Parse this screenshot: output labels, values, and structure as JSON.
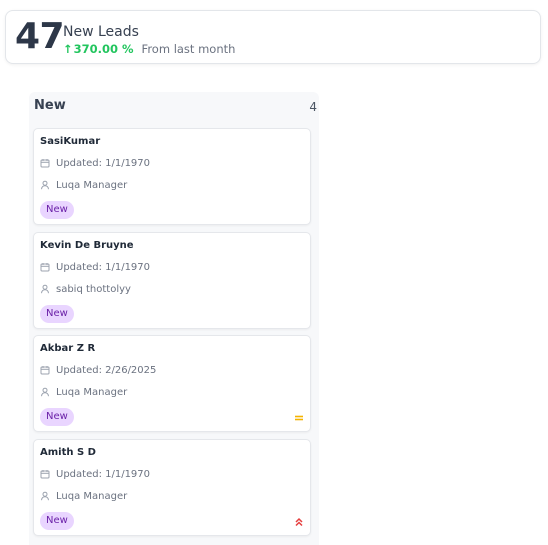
{
  "stat": {
    "number": "47",
    "title": "New Leads",
    "change": "370.00 %",
    "period": "From last month"
  },
  "column": {
    "title": "New",
    "count": "4",
    "cards": [
      {
        "name": "SasiKumar",
        "updated": "Updated: 1/1/1970",
        "owner": "Luqa Manager",
        "status": "New",
        "priority": ""
      },
      {
        "name": "Kevin De Bruyne",
        "updated": "Updated: 1/1/1970",
        "owner": "sabiq thottolyy",
        "status": "New",
        "priority": ""
      },
      {
        "name": "Akbar Z R",
        "updated": "Updated: 2/26/2025",
        "owner": "Luqa Manager",
        "status": "New",
        "priority": "medium"
      },
      {
        "name": "Amith S D",
        "updated": "Updated: 1/1/1970",
        "owner": "Luqa Manager",
        "status": "New",
        "priority": "high"
      }
    ]
  },
  "colors": {
    "up": "#22c55e",
    "badge_bg": "#e9d5ff",
    "badge_text": "#6b21a8",
    "priority_medium": "#f5b400",
    "priority_high": "#e53e3e"
  },
  "icons": {
    "updated": "calendar-icon",
    "owner": "user-icon",
    "change": "arrow-up-icon"
  }
}
